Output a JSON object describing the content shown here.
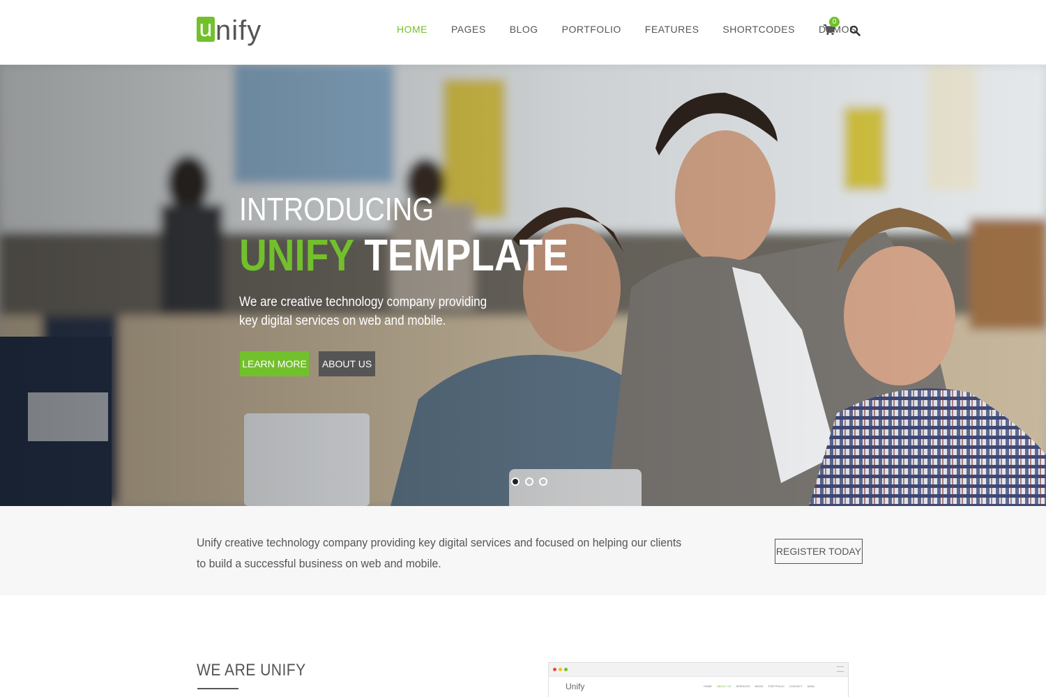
{
  "header": {
    "logo_letter": "u",
    "logo_rest": "nify",
    "nav": [
      "HOME",
      "PAGES",
      "BLOG",
      "PORTFOLIO",
      "FEATURES",
      "SHORTCODES",
      "DEMOS"
    ],
    "cart_count": "0"
  },
  "hero": {
    "pre_title": "INTRODUCING",
    "title_accent": "UNIFY",
    "title_rest": "TEMPLATE",
    "description": "We are creative technology company providing key digital services on web and mobile.",
    "learn_more": "LEARN MORE",
    "about_us": "ABOUT US",
    "slides_total": 3,
    "slide_active": 1
  },
  "promo": {
    "text": "Unify creative technology company providing key digital services and focused on helping our clients to build a successful business on web and mobile.",
    "register": "REGISTER TODAY"
  },
  "about": {
    "title": "WE ARE UNIFY"
  },
  "browser_preview": {
    "logo": "Unify",
    "nav": [
      "HOME",
      "ABOUT US",
      "SERVICES",
      "NEWS",
      "PORTFOLIO",
      "CONTACT",
      "MAIN"
    ],
    "dot_colors": [
      "#e74c3c",
      "#f1c40f",
      "#72c02c"
    ]
  },
  "colors": {
    "accent": "#72c02c",
    "dark_button": "#555555",
    "band": "#f7f7f7"
  },
  "icons": {
    "cart": "shopping-cart-icon",
    "search": "search-icon"
  }
}
